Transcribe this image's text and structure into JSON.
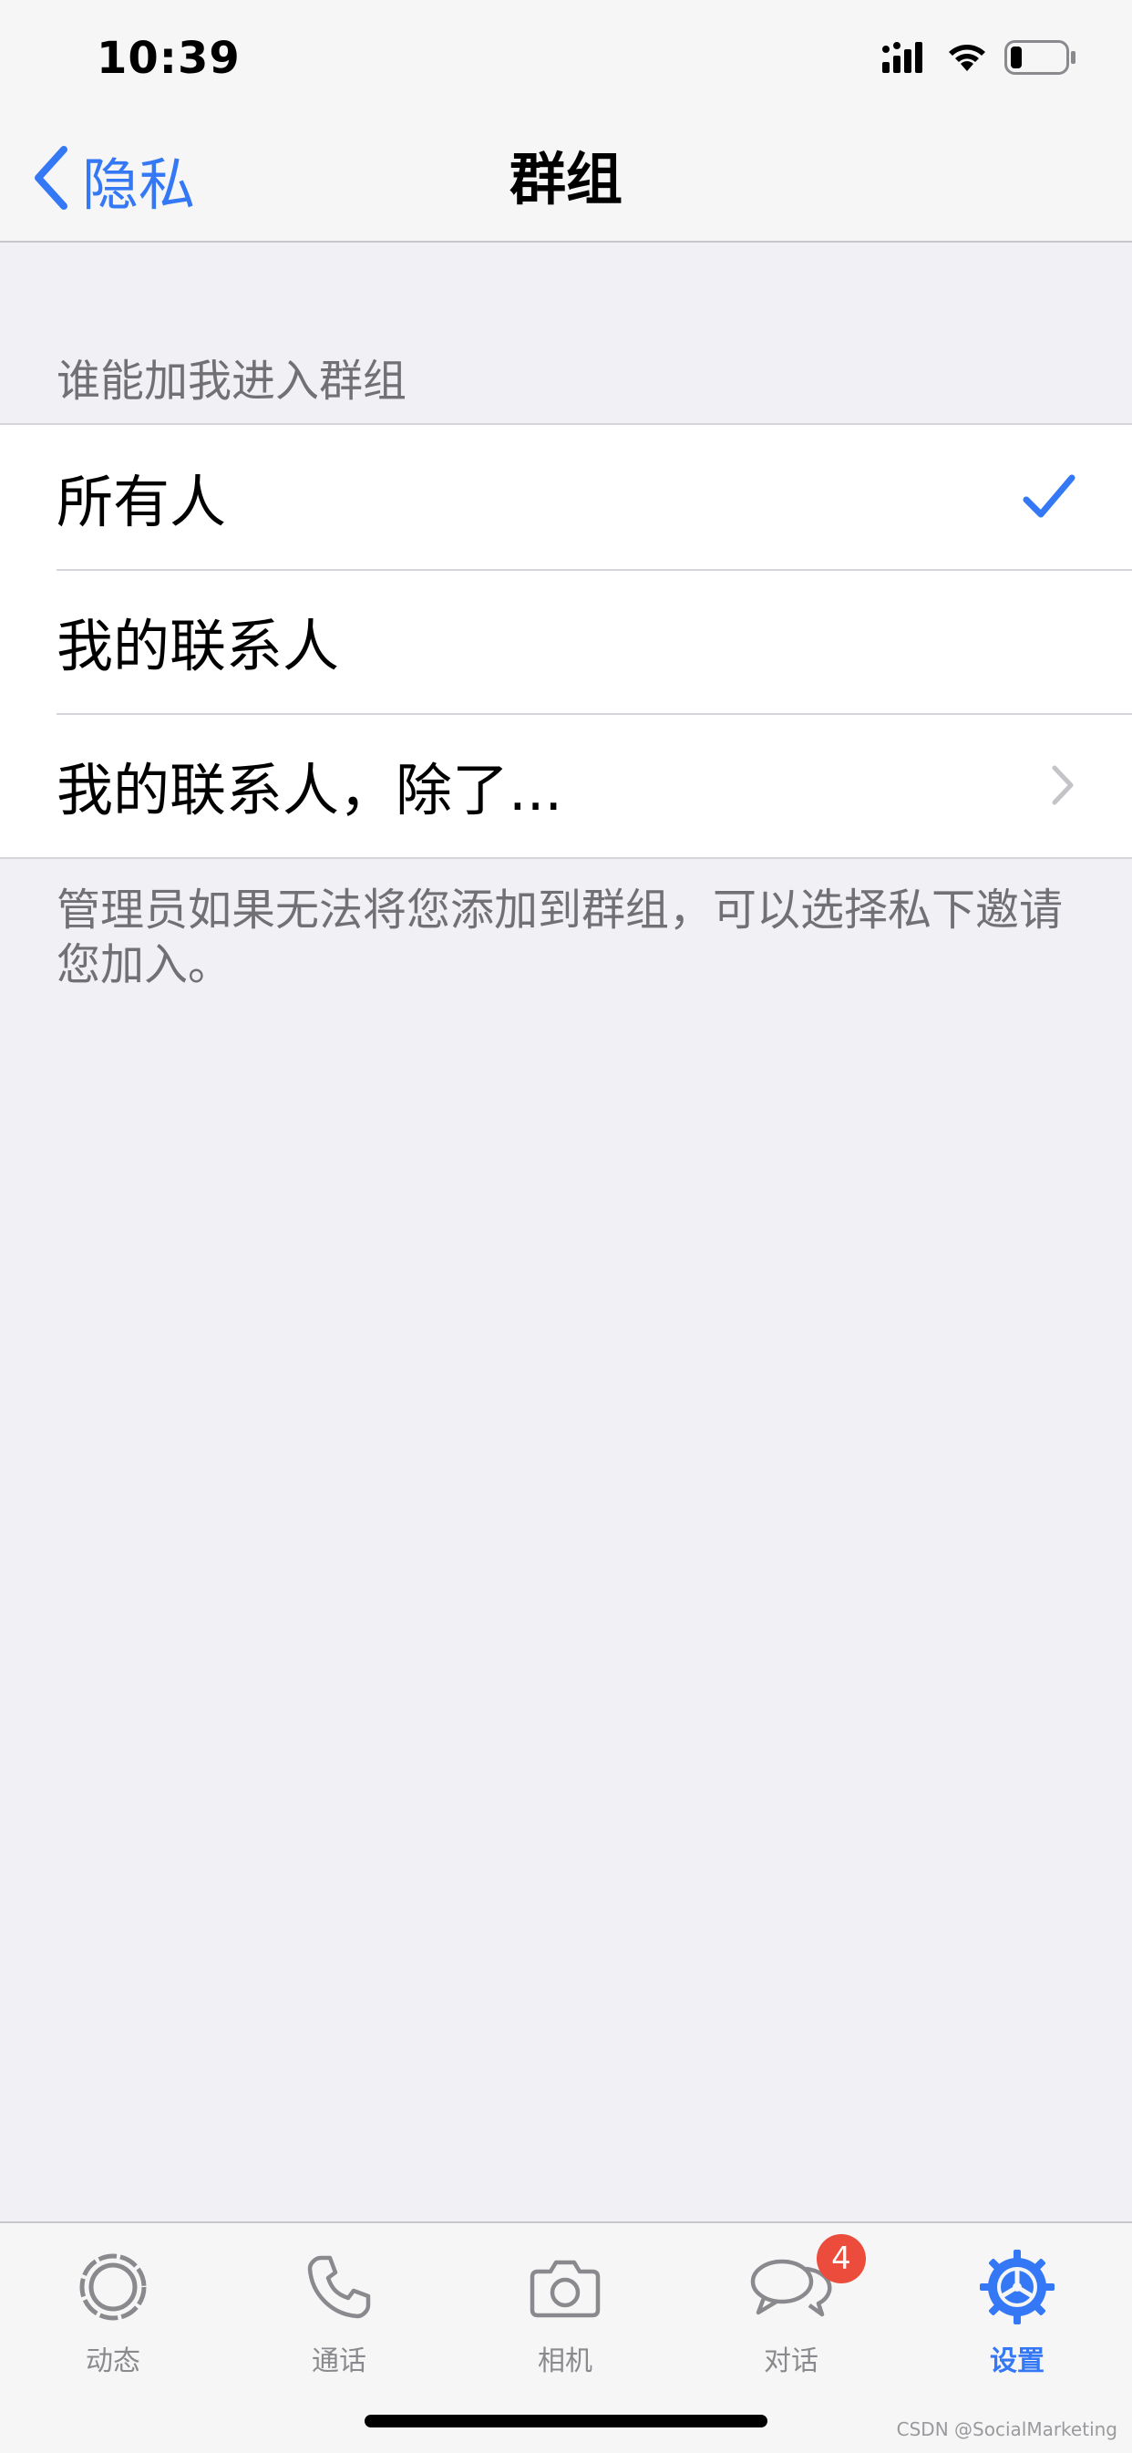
{
  "status_bar": {
    "time": "10:39"
  },
  "nav": {
    "back_label": "隐私",
    "title": "群组"
  },
  "section": {
    "header": "谁能加我进入群组",
    "options": [
      {
        "label": "所有人",
        "accessory": "checkmark-icon"
      },
      {
        "label": "我的联系人",
        "accessory": ""
      },
      {
        "label": "我的联系人，除了...",
        "accessory": "chevron-right-icon"
      }
    ],
    "footer": "管理员如果无法将您添加到群组，可以选择私下邀请您加入。"
  },
  "tabs": [
    {
      "label": "动态",
      "icon": "status-icon"
    },
    {
      "label": "通话",
      "icon": "phone-icon"
    },
    {
      "label": "相机",
      "icon": "camera-icon"
    },
    {
      "label": "对话",
      "icon": "chats-icon",
      "badge": "4"
    },
    {
      "label": "设置",
      "icon": "settings-icon",
      "active": true
    }
  ],
  "watermark": "CSDN @SocialMarketing",
  "colors": {
    "accent": "#3478f6",
    "badge": "#ec4c3c",
    "secondary_text": "#707075",
    "background": "#f0f0f5"
  }
}
